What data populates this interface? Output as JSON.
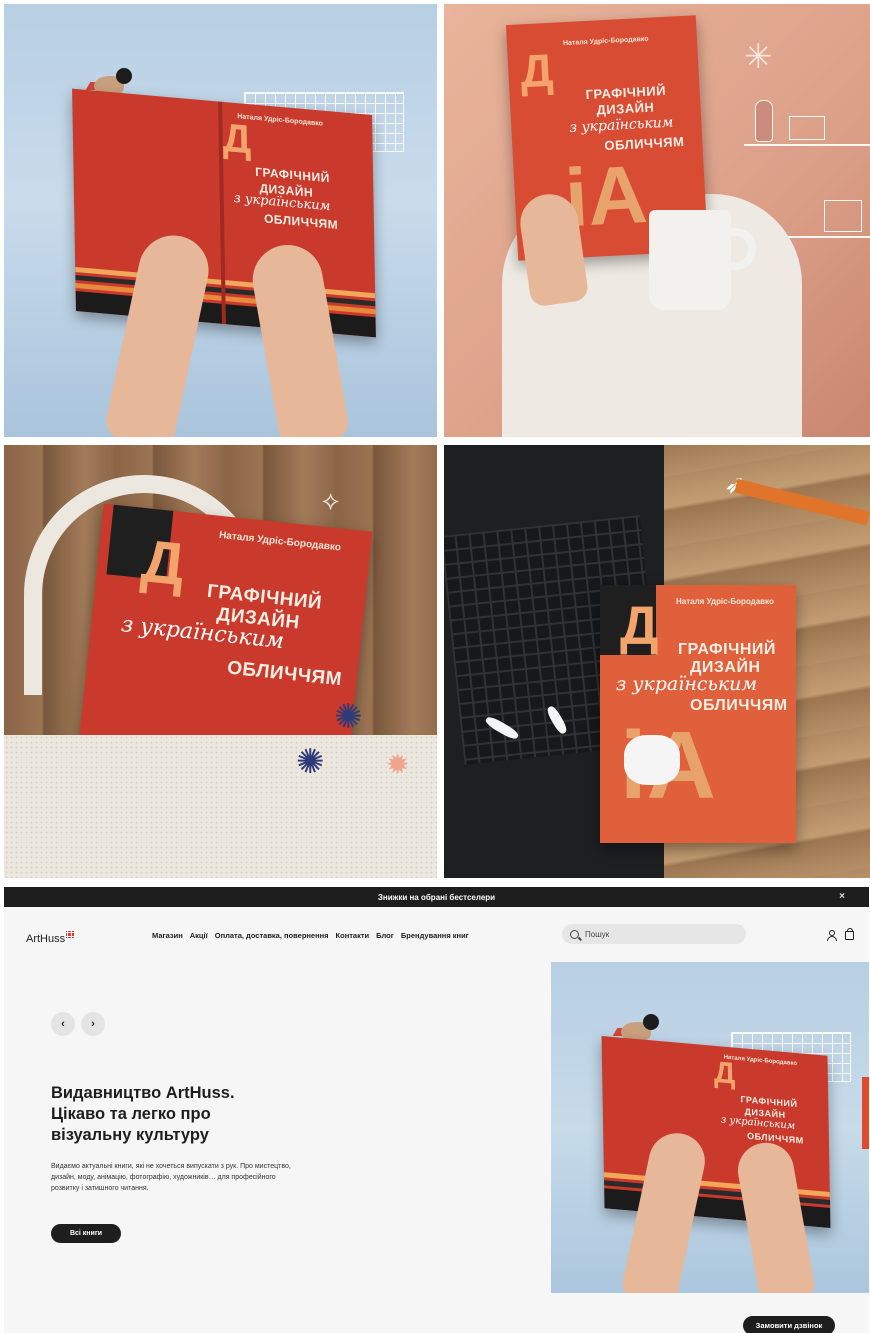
{
  "photos": {
    "book_author": "Наталя Удріс-Бородавко",
    "book_title_line1": "ГРАФІЧНИЙ",
    "book_title_line2": "ДИЗАЙН",
    "book_title_script": "з українським",
    "book_title_line3": "ОБЛИЧЧЯМ",
    "book_letter": "Д",
    "book_ua": "iA",
    "colors": {
      "cover_red": "#c93a2c",
      "cover_orange": "#e4613f",
      "sky": "#b7cfe3"
    }
  },
  "site": {
    "announcement": "Знижки на обрані бестселери",
    "close_label": "×",
    "logo": "ArtHuss",
    "menu": [
      "Магазин",
      "Акції",
      "Оплата, доставка, повернення",
      "Контакти",
      "Блог",
      "Брендування книг"
    ],
    "search_placeholder": "Пошук",
    "prev_label": "‹",
    "next_label": "›",
    "hero_title_lines": [
      "Видавництво ArtHuss.",
      "Цікаво та легко про",
      "візуальну культуру"
    ],
    "hero_description": "Видаємо актуальні книги, які не хочеться випускати з рук. Про мистецтво, дизайн, моду, анімацію, фотографію, художників… для професійного розвитку і затишного читання.",
    "all_books_label": "Всі книги",
    "call_button_label": "Замовити дзвінок"
  }
}
